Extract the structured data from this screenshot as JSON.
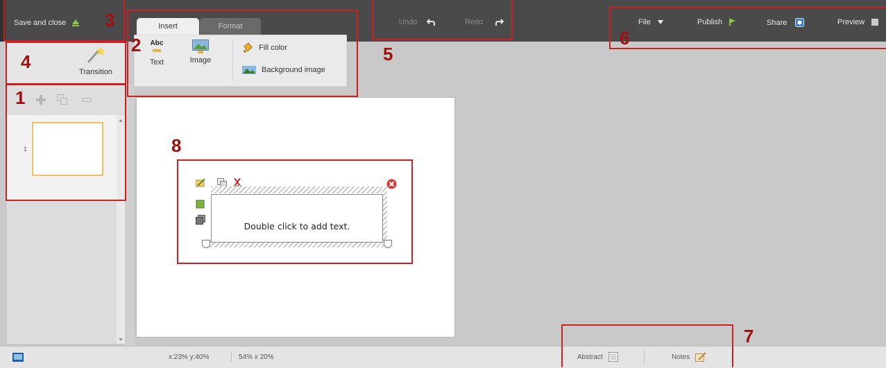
{
  "topbar": {
    "save_close": "Save and close",
    "undo": "Undo",
    "redo": "Redo",
    "file": "File",
    "publish": "Publish",
    "share": "Share",
    "preview": "Preview"
  },
  "ribbon": {
    "tabs": [
      {
        "label": "Insert",
        "active": true
      },
      {
        "label": "Format",
        "active": false
      }
    ],
    "text_button": "Text",
    "text_icon_label": "Abc",
    "image_button": "Image",
    "fill_color": "Fill color",
    "background_image": "Background image"
  },
  "left_panel": {
    "transition": "Transition",
    "slides": [
      {
        "number": "1"
      }
    ]
  },
  "canvas": {
    "placeholder": "Double click to add text."
  },
  "statusbar": {
    "coords": "x:23% y:40%",
    "size": "54% x 20%",
    "abstract": "Abstract",
    "notes": "Notes"
  },
  "annotations": [
    "1",
    "2",
    "3",
    "4",
    "5",
    "6",
    "7",
    "8"
  ],
  "colors": {
    "topbar": "#4a4a4a",
    "annotation_red": "#cc1f1f",
    "annotation_number": "#a01010",
    "thumb_border": "#f0c060"
  }
}
